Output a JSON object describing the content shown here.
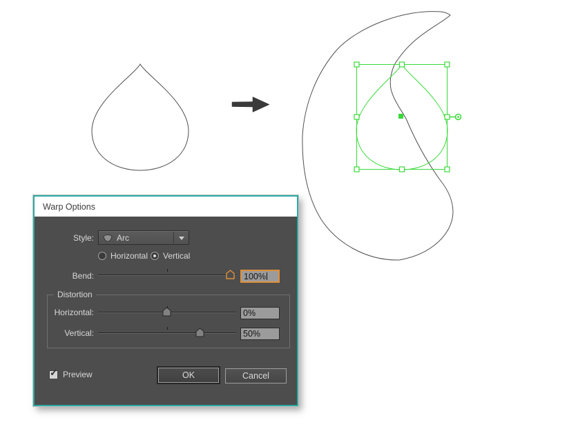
{
  "window": {
    "title": "Warp Options"
  },
  "canvas": {
    "source_shape": "teardrop-outline",
    "result_shape": "arc-warped-crescent",
    "selection_color": "#38da38",
    "path_stroke_color": "#4f4f4f"
  },
  "dialog": {
    "title": "Warp Options",
    "style": {
      "label": "Style:",
      "value": "Arc",
      "icon": "arc-warp-icon"
    },
    "orientation": {
      "horizontal": "Horizontal",
      "vertical": "Vertical",
      "selected": "Vertical"
    },
    "bend": {
      "label": "Bend:",
      "value": "100%",
      "slider_pos": 95.8
    },
    "distortion": {
      "legend": "Distortion",
      "horizontal": {
        "label": "Horizontal:",
        "value": "0%",
        "slider_pos": 49.5
      },
      "vertical": {
        "label": "Vertical:",
        "value": "50%",
        "slider_pos": 73.5
      }
    },
    "preview": {
      "label": "Preview",
      "checked": true
    },
    "buttons": {
      "ok": "OK",
      "cancel": "Cancel"
    }
  },
  "colors": {
    "accent_teal": "#2ba9a2",
    "focus_orange": "#e0913a",
    "selection_green": "#38da38",
    "dialog_bg": "#4d4d4d"
  }
}
